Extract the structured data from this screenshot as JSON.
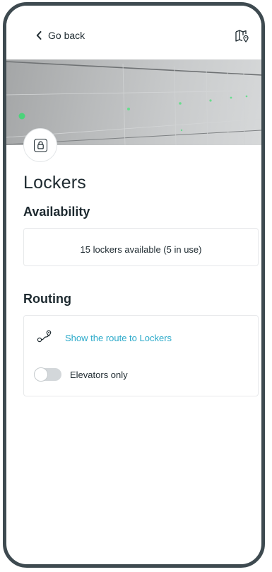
{
  "header": {
    "back_label": "Go back",
    "back_icon": "chevron-left-icon",
    "map_icon": "map-pin-icon"
  },
  "hero": {
    "image": "lockers-photo",
    "badge_icon": "lock-icon"
  },
  "page": {
    "title": "Lockers"
  },
  "availability": {
    "heading": "Availability",
    "text": "15 lockers available (5 in use)"
  },
  "routing": {
    "heading": "Routing",
    "route_link": "Show the route to Lockers",
    "route_icon": "route-icon",
    "elevators_label": "Elevators only",
    "elevators_on": false
  },
  "colors": {
    "accent": "#2aa9c9",
    "text": "#1e2a30",
    "frame": "#3e4a50"
  }
}
